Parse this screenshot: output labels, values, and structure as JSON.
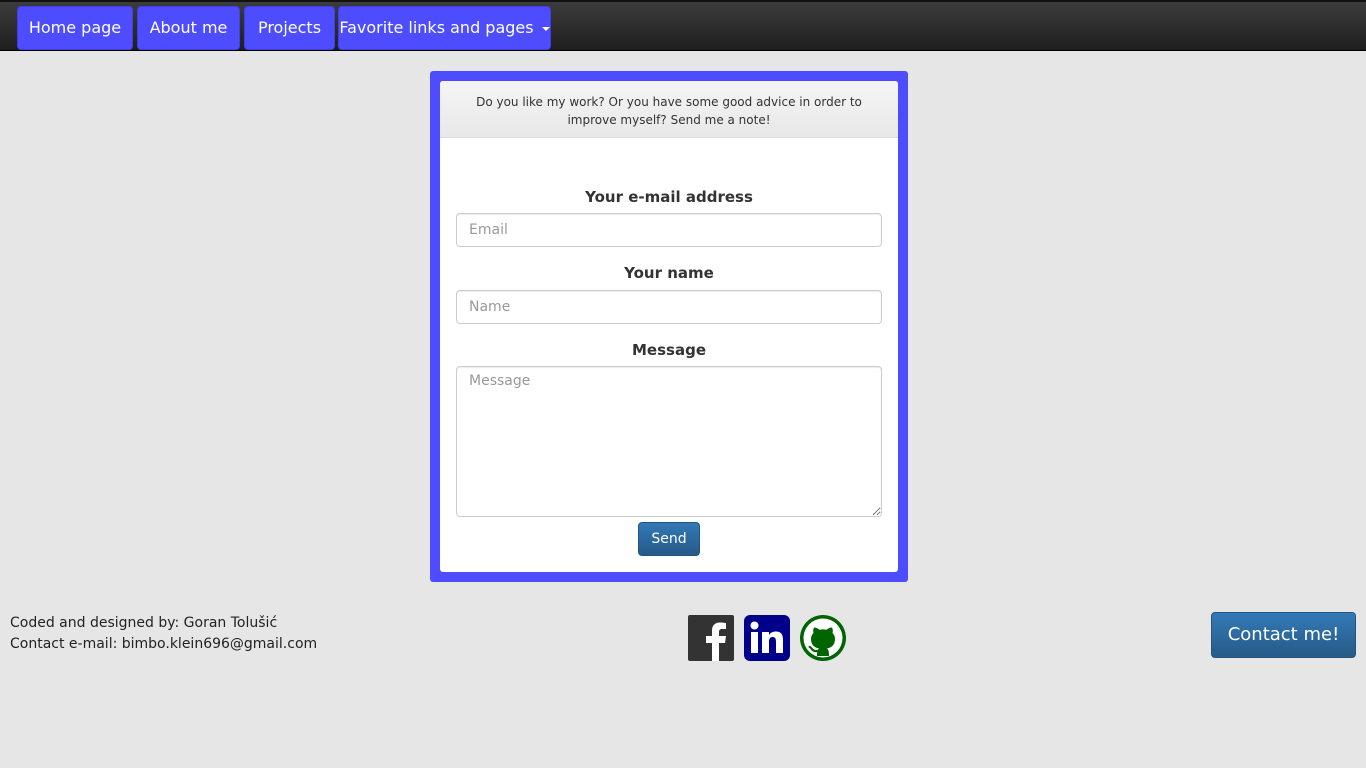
{
  "nav": {
    "items": [
      {
        "label": "Home page"
      },
      {
        "label": "About me"
      },
      {
        "label": "Projects"
      },
      {
        "label": "Favorite links and pages"
      }
    ]
  },
  "panel": {
    "heading": "Do you like my work? Or you have some good advice in order to improve myself? Send me a note!",
    "email": {
      "label": "Your e-mail address",
      "placeholder": "Email",
      "value": ""
    },
    "name": {
      "label": "Your name",
      "placeholder": "Name",
      "value": ""
    },
    "message": {
      "label": "Message",
      "placeholder": "Message",
      "value": ""
    },
    "send_label": "Send"
  },
  "footer": {
    "credit": "Coded and designed by: Goran Tolušić",
    "contact": "Contact e-mail: bimbo.klein696@gmail.com",
    "social": [
      {
        "icon": "facebook-icon"
      },
      {
        "icon": "linkedin-icon"
      },
      {
        "icon": "github-icon"
      }
    ],
    "contact_button": "Contact me!"
  },
  "colors": {
    "accent": "#4d4dff",
    "primary_button": "#2a6496",
    "background": "#e6e6e6"
  }
}
